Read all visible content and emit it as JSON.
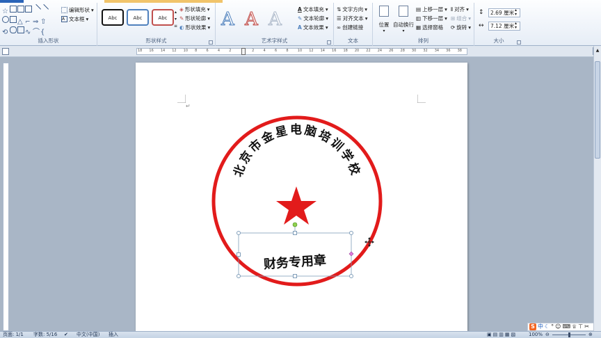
{
  "shapes_group": {
    "edit_shape": "编辑形状",
    "text_box": "文本框",
    "label": "插入形状"
  },
  "styles_group": {
    "presets": [
      "Abc",
      "Abc",
      "Abc"
    ],
    "fill": "形状填充",
    "outline": "形状轮廓",
    "effects": "形状效果",
    "label": "形状样式"
  },
  "wordart_group": {
    "letters": [
      "A",
      "A",
      "A"
    ],
    "text_fill": "文本填充",
    "text_outline": "文本轮廓",
    "text_effects": "文本效果",
    "label": "艺术字样式"
  },
  "text_group": {
    "direction": "文字方向",
    "align": "对齐文本",
    "link": "创建链接",
    "label": "文本"
  },
  "arrange_group": {
    "position": "位置",
    "wrap": "自动换行",
    "bring_forward": "上移一层",
    "send_backward": "下移一层",
    "selection_pane": "选择窗格",
    "align": "对齐",
    "group": "组合",
    "rotate": "旋转",
    "label": "排列"
  },
  "size_group": {
    "height": "2.69 厘米",
    "width": "7.12 厘米",
    "label": "大小"
  },
  "ruler": {
    "ticks": [
      "18",
      "16",
      "14",
      "12",
      "10",
      "8",
      "6",
      "4",
      "2",
      "",
      "2",
      "4",
      "6",
      "8",
      "10",
      "12",
      "14",
      "16",
      "18",
      "20",
      "22",
      "24",
      "26",
      "28",
      "30",
      "32",
      "34",
      "36",
      "38"
    ]
  },
  "document": {
    "paragraph_mark": "↵",
    "seal": {
      "arc_text": "北京市金星电脑培训学校",
      "bottom_text": "财务专用章",
      "color": "#e21b1b"
    }
  },
  "status": {
    "page": "页面: 1/1",
    "words": "字数: 5/16",
    "language": "中文(中国)",
    "mode": "插入",
    "zoom": "100%"
  },
  "ime": {
    "logo": "S",
    "lang": "中"
  },
  "colors": {
    "ribbon_bg": "#e6edf6",
    "app_bg": "#a9b6c6",
    "accent": "#2a64b8"
  }
}
